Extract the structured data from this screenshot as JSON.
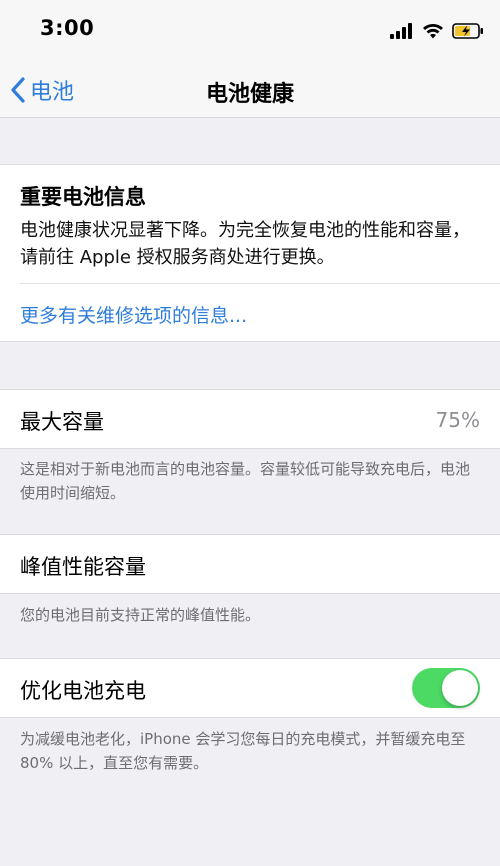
{
  "status_bar": {
    "time": "3:00",
    "icons": [
      "signal-icon",
      "wifi-icon",
      "battery-charging-icon"
    ],
    "battery_color": "#f2c530"
  },
  "nav": {
    "back_label": "电池",
    "title": "电池健康"
  },
  "important": {
    "title": "重要电池信息",
    "body": "电池健康状况显著下降。为完全恢复电池的性能和容量，请前往 Apple 授权服务商处进行更换。",
    "link": "更多有关维修选项的信息..."
  },
  "max_capacity": {
    "label": "最大容量",
    "value": "75%",
    "footnote": "这是相对于新电池而言的电池容量。容量较低可能导致充电后，电池使用时间缩短。"
  },
  "peak_performance": {
    "label": "峰值性能容量",
    "footnote": "您的电池目前支持正常的峰值性能。"
  },
  "optimized_charging": {
    "label": "优化电池充电",
    "enabled": true,
    "toggle_color": "#4cd964",
    "footnote": "为减缓电池老化，iPhone 会学习您每日的充电模式，并暂缓充电至 80% 以上，直至您有需要。"
  },
  "colors": {
    "accent": "#2f7ddb",
    "background": "#efeff4"
  }
}
